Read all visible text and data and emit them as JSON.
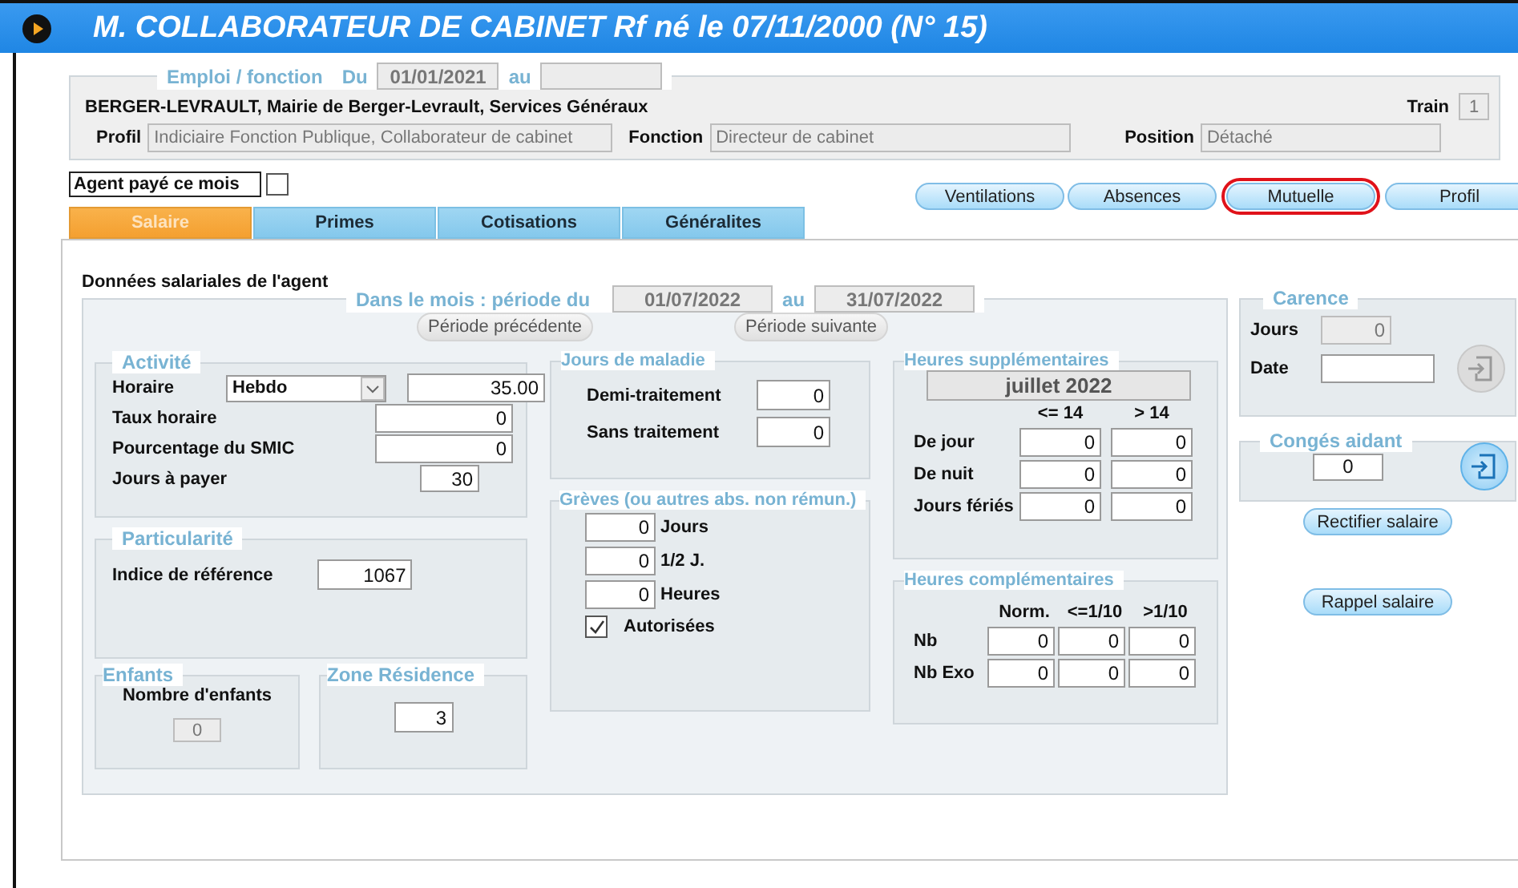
{
  "window": {
    "title": "M. COLLABORATEUR DE CABINET Rf né le 07/11/2000 (N° 15)"
  },
  "emploi": {
    "legend": "Emploi / fonction",
    "du_label": "Du",
    "du": "01/01/2021",
    "au_label": "au",
    "employer": "BERGER-LEVRAULT, Mairie de Berger-Levrault, Services Généraux",
    "train_label": "Train",
    "train": "1",
    "fields": [
      {
        "label": "Profil",
        "value": "Indiciaire Fonction Publique, Collaborateur de cabinet"
      },
      {
        "label": "Fonction",
        "value": "Directeur de cabinet"
      },
      {
        "label": "Position",
        "value": "Détaché"
      }
    ]
  },
  "agent_paye": {
    "label": "Agent payé ce mois",
    "checked": false
  },
  "actions": [
    {
      "label": "Ventilations",
      "highlighted": false
    },
    {
      "label": "Absences",
      "highlighted": false
    },
    {
      "label": "Mutuelle",
      "highlighted": true
    },
    {
      "label": "Profil",
      "highlighted": false
    }
  ],
  "tabs": [
    {
      "label": "Salaire",
      "selected": true
    },
    {
      "label": "Primes",
      "selected": false
    },
    {
      "label": "Cotisations",
      "selected": false
    },
    {
      "label": "Généralites",
      "selected": false
    }
  ],
  "section_title": "Données salariales de l'agent",
  "period": {
    "label": "Dans le mois : période du",
    "from": "01/07/2022",
    "au_label": "au",
    "to": "31/07/2022",
    "buttons": [
      "Période précédente",
      "Période suivante"
    ]
  },
  "activite": {
    "legend": "Activité",
    "horaire_label": "Horaire",
    "horaire_option": "Hebdo",
    "horaire_value": "35.00",
    "rows": [
      {
        "label": "Taux horaire",
        "value": "0",
        "kind": "wide"
      },
      {
        "label": "Pourcentage du SMIC",
        "value": "0",
        "kind": "wide"
      },
      {
        "label": "Jours à payer",
        "value": "30",
        "kind": "narrow"
      }
    ]
  },
  "particularite": {
    "legend": "Particularité",
    "label": "Indice de référence",
    "value": "1067"
  },
  "enfants": {
    "legend": "Enfants",
    "label": "Nombre d'enfants",
    "value": "0"
  },
  "zone": {
    "legend": "Zone Résidence",
    "value": "3"
  },
  "maladie": {
    "legend": "Jours de maladie",
    "rows": [
      {
        "label": "Demi-traitement",
        "value": "0"
      },
      {
        "label": "Sans traitement",
        "value": "0"
      }
    ]
  },
  "greves": {
    "legend": "Grèves (ou autres abs. non rémun.)",
    "rows": [
      {
        "value": "0",
        "label": "Jours"
      },
      {
        "value": "0",
        "label": "1/2 J."
      },
      {
        "value": "0",
        "label": "Heures"
      }
    ],
    "autorisees": {
      "label": "Autorisées",
      "checked": true
    }
  },
  "heures_sup": {
    "legend": "Heures supplémentaires",
    "month": "juillet 2022",
    "columns": [
      "<= 14",
      "> 14"
    ],
    "rows": [
      {
        "label": "De jour",
        "values": [
          "0",
          "0"
        ]
      },
      {
        "label": "De nuit",
        "values": [
          "0",
          "0"
        ]
      },
      {
        "label": "Jours fériés",
        "values": [
          "0",
          "0"
        ]
      }
    ]
  },
  "heures_comp": {
    "legend": "Heures complémentaires",
    "columns": [
      "Norm.",
      "<=1/10",
      ">1/10"
    ],
    "rows": [
      {
        "label": "Nb",
        "values": [
          "0",
          "0",
          "0"
        ]
      },
      {
        "label": "Nb Exo",
        "values": [
          "0",
          "0",
          "0"
        ]
      }
    ]
  },
  "carence": {
    "legend": "Carence",
    "jours_label": "Jours",
    "jours": "0",
    "date_label": "Date",
    "button_disabled": true
  },
  "conges_aidant": {
    "legend": "Congés aidant",
    "value": "0",
    "button_disabled": false
  },
  "side_buttons": [
    "Rectifier salaire",
    "Rappel salaire"
  ]
}
